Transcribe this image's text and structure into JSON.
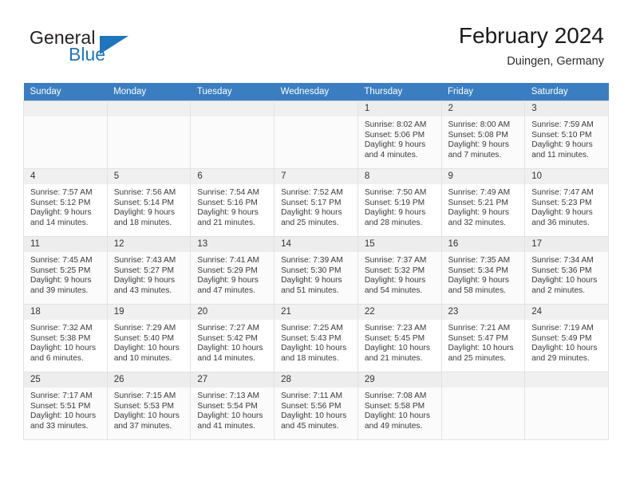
{
  "brand": {
    "word1": "General",
    "word2": "Blue",
    "logo_icon": "triangle-logo-icon",
    "accent_color": "#1f76bc"
  },
  "header": {
    "title": "February 2024",
    "subtitle": "Duingen, Germany"
  },
  "calendar": {
    "header_bg": "#3a7ec1",
    "weekdays": [
      "Sunday",
      "Monday",
      "Tuesday",
      "Wednesday",
      "Thursday",
      "Friday",
      "Saturday"
    ],
    "weeks": [
      [
        {
          "day": "",
          "lines": []
        },
        {
          "day": "",
          "lines": []
        },
        {
          "day": "",
          "lines": []
        },
        {
          "day": "",
          "lines": []
        },
        {
          "day": "1",
          "lines": [
            "Sunrise: 8:02 AM",
            "Sunset: 5:06 PM",
            "Daylight: 9 hours",
            "and 4 minutes."
          ]
        },
        {
          "day": "2",
          "lines": [
            "Sunrise: 8:00 AM",
            "Sunset: 5:08 PM",
            "Daylight: 9 hours",
            "and 7 minutes."
          ]
        },
        {
          "day": "3",
          "lines": [
            "Sunrise: 7:59 AM",
            "Sunset: 5:10 PM",
            "Daylight: 9 hours",
            "and 11 minutes."
          ]
        }
      ],
      [
        {
          "day": "4",
          "lines": [
            "Sunrise: 7:57 AM",
            "Sunset: 5:12 PM",
            "Daylight: 9 hours",
            "and 14 minutes."
          ]
        },
        {
          "day": "5",
          "lines": [
            "Sunrise: 7:56 AM",
            "Sunset: 5:14 PM",
            "Daylight: 9 hours",
            "and 18 minutes."
          ]
        },
        {
          "day": "6",
          "lines": [
            "Sunrise: 7:54 AM",
            "Sunset: 5:16 PM",
            "Daylight: 9 hours",
            "and 21 minutes."
          ]
        },
        {
          "day": "7",
          "lines": [
            "Sunrise: 7:52 AM",
            "Sunset: 5:17 PM",
            "Daylight: 9 hours",
            "and 25 minutes."
          ]
        },
        {
          "day": "8",
          "lines": [
            "Sunrise: 7:50 AM",
            "Sunset: 5:19 PM",
            "Daylight: 9 hours",
            "and 28 minutes."
          ]
        },
        {
          "day": "9",
          "lines": [
            "Sunrise: 7:49 AM",
            "Sunset: 5:21 PM",
            "Daylight: 9 hours",
            "and 32 minutes."
          ]
        },
        {
          "day": "10",
          "lines": [
            "Sunrise: 7:47 AM",
            "Sunset: 5:23 PM",
            "Daylight: 9 hours",
            "and 36 minutes."
          ]
        }
      ],
      [
        {
          "day": "11",
          "lines": [
            "Sunrise: 7:45 AM",
            "Sunset: 5:25 PM",
            "Daylight: 9 hours",
            "and 39 minutes."
          ]
        },
        {
          "day": "12",
          "lines": [
            "Sunrise: 7:43 AM",
            "Sunset: 5:27 PM",
            "Daylight: 9 hours",
            "and 43 minutes."
          ]
        },
        {
          "day": "13",
          "lines": [
            "Sunrise: 7:41 AM",
            "Sunset: 5:29 PM",
            "Daylight: 9 hours",
            "and 47 minutes."
          ]
        },
        {
          "day": "14",
          "lines": [
            "Sunrise: 7:39 AM",
            "Sunset: 5:30 PM",
            "Daylight: 9 hours",
            "and 51 minutes."
          ]
        },
        {
          "day": "15",
          "lines": [
            "Sunrise: 7:37 AM",
            "Sunset: 5:32 PM",
            "Daylight: 9 hours",
            "and 54 minutes."
          ]
        },
        {
          "day": "16",
          "lines": [
            "Sunrise: 7:35 AM",
            "Sunset: 5:34 PM",
            "Daylight: 9 hours",
            "and 58 minutes."
          ]
        },
        {
          "day": "17",
          "lines": [
            "Sunrise: 7:34 AM",
            "Sunset: 5:36 PM",
            "Daylight: 10 hours",
            "and 2 minutes."
          ]
        }
      ],
      [
        {
          "day": "18",
          "lines": [
            "Sunrise: 7:32 AM",
            "Sunset: 5:38 PM",
            "Daylight: 10 hours",
            "and 6 minutes."
          ]
        },
        {
          "day": "19",
          "lines": [
            "Sunrise: 7:29 AM",
            "Sunset: 5:40 PM",
            "Daylight: 10 hours",
            "and 10 minutes."
          ]
        },
        {
          "day": "20",
          "lines": [
            "Sunrise: 7:27 AM",
            "Sunset: 5:42 PM",
            "Daylight: 10 hours",
            "and 14 minutes."
          ]
        },
        {
          "day": "21",
          "lines": [
            "Sunrise: 7:25 AM",
            "Sunset: 5:43 PM",
            "Daylight: 10 hours",
            "and 18 minutes."
          ]
        },
        {
          "day": "22",
          "lines": [
            "Sunrise: 7:23 AM",
            "Sunset: 5:45 PM",
            "Daylight: 10 hours",
            "and 21 minutes."
          ]
        },
        {
          "day": "23",
          "lines": [
            "Sunrise: 7:21 AM",
            "Sunset: 5:47 PM",
            "Daylight: 10 hours",
            "and 25 minutes."
          ]
        },
        {
          "day": "24",
          "lines": [
            "Sunrise: 7:19 AM",
            "Sunset: 5:49 PM",
            "Daylight: 10 hours",
            "and 29 minutes."
          ]
        }
      ],
      [
        {
          "day": "25",
          "lines": [
            "Sunrise: 7:17 AM",
            "Sunset: 5:51 PM",
            "Daylight: 10 hours",
            "and 33 minutes."
          ]
        },
        {
          "day": "26",
          "lines": [
            "Sunrise: 7:15 AM",
            "Sunset: 5:53 PM",
            "Daylight: 10 hours",
            "and 37 minutes."
          ]
        },
        {
          "day": "27",
          "lines": [
            "Sunrise: 7:13 AM",
            "Sunset: 5:54 PM",
            "Daylight: 10 hours",
            "and 41 minutes."
          ]
        },
        {
          "day": "28",
          "lines": [
            "Sunrise: 7:11 AM",
            "Sunset: 5:56 PM",
            "Daylight: 10 hours",
            "and 45 minutes."
          ]
        },
        {
          "day": "29",
          "lines": [
            "Sunrise: 7:08 AM",
            "Sunset: 5:58 PM",
            "Daylight: 10 hours",
            "and 49 minutes."
          ]
        },
        {
          "day": "",
          "lines": []
        },
        {
          "day": "",
          "lines": []
        }
      ]
    ]
  }
}
